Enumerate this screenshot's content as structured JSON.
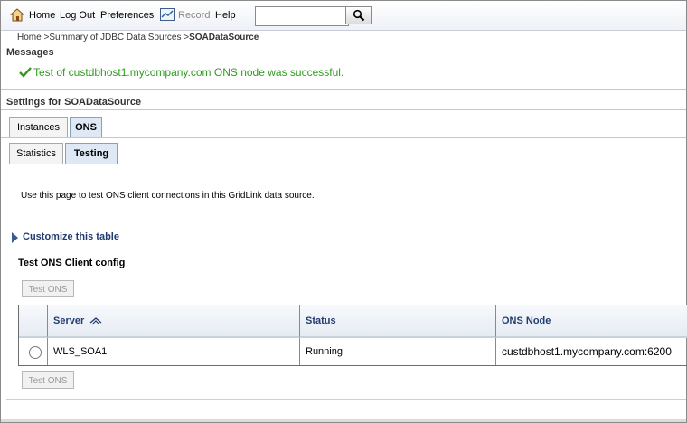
{
  "toolbar": {
    "home": "Home",
    "logout": "Log Out",
    "preferences": "Preferences",
    "record": "Record",
    "help": "Help",
    "search_placeholder": ""
  },
  "breadcrumb": {
    "home": "Home",
    "sep1": " >",
    "summary": "Summary of JDBC Data Sources",
    "sep2": " >",
    "current": "SOADataSource"
  },
  "messages": {
    "title": "Messages",
    "text": "Test of custdbhost1.mycompany.com ONS node was successful."
  },
  "settings_title": "Settings for SOADataSource",
  "tabs": [
    "Instances",
    "ONS"
  ],
  "subtabs": [
    "Statistics",
    "Testing"
  ],
  "description": "Use this page to test ONS client connections in this GridLink data source.",
  "customize": "Customize this table",
  "table": {
    "title": "Test ONS Client config",
    "button": "Test ONS",
    "columns": [
      "Server",
      "Status",
      "ONS Node"
    ],
    "rows": [
      [
        "WLS_SOA1",
        "Running",
        "custdbhost1.mycompany.com:6200"
      ]
    ]
  }
}
